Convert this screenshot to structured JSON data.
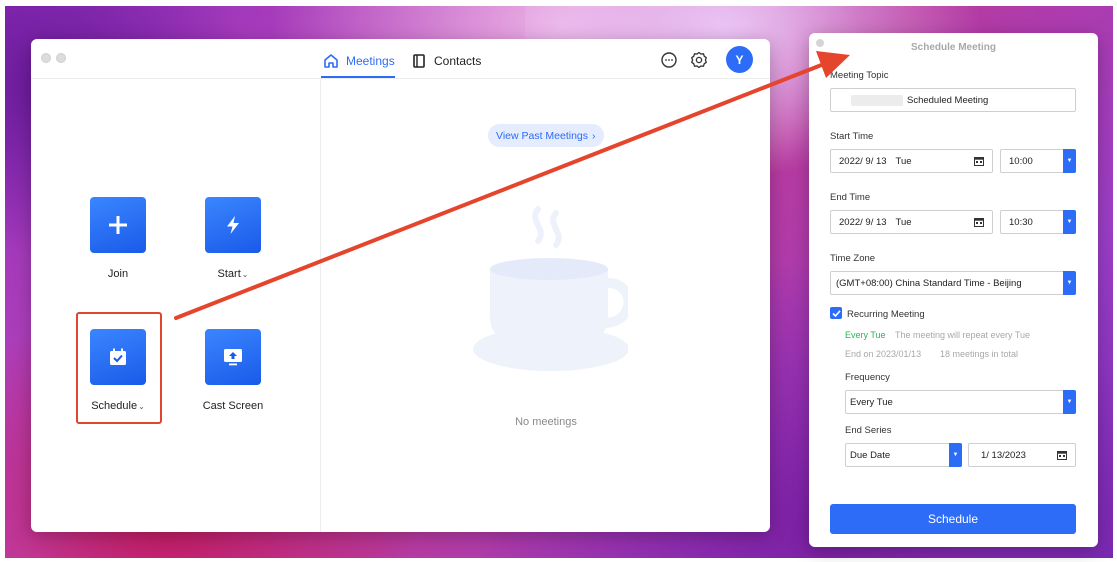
{
  "main_window": {
    "tabs": [
      {
        "label": "Meetings",
        "icon": "home-icon",
        "active": true
      },
      {
        "label": "Contacts",
        "icon": "contacts-icon",
        "active": false
      }
    ],
    "avatar_initial": "Y",
    "actions": [
      {
        "label": "Join",
        "icon": "plus-icon",
        "has_dropdown": false
      },
      {
        "label": "Start",
        "icon": "lightning-icon",
        "has_dropdown": true
      },
      {
        "label": "Schedule",
        "icon": "calendar-icon",
        "has_dropdown": true
      },
      {
        "label": "Cast Screen",
        "icon": "screen-share-icon",
        "has_dropdown": false
      }
    ],
    "view_past_label": "View Past Meetings",
    "empty_text": "No meetings"
  },
  "schedule_panel": {
    "title": "Schedule Meeting",
    "topic_label": "Meeting Topic",
    "topic_value": "Scheduled Meeting",
    "start_label": "Start Time",
    "start_date": "2022/ 9/ 13",
    "start_day": "Tue",
    "start_time": "10:00",
    "end_label": "End Time",
    "end_date": "2022/ 9/ 13",
    "end_day": "Tue",
    "end_time": "10:30",
    "timezone_label": "Time Zone",
    "timezone_value": "(GMT+08:00) China Standard Time - Beijing",
    "recurring_label": "Recurring Meeting",
    "recurring_checked": true,
    "recurring_every": "Every Tue",
    "recurring_note": "The meeting will repeat every Tue",
    "recurring_end": "End on 2023/01/13",
    "recurring_count": "18 meetings in total",
    "frequency_label": "Frequency",
    "frequency_value": "Every Tue",
    "end_series_label": "End Series",
    "end_series_type": "Due Date",
    "end_series_date": "1/ 13/2023",
    "schedule_button": "Schedule"
  },
  "colors": {
    "accent": "#2d6cf6",
    "annotation": "#e0462e",
    "recurring_green": "#2bb25a"
  }
}
